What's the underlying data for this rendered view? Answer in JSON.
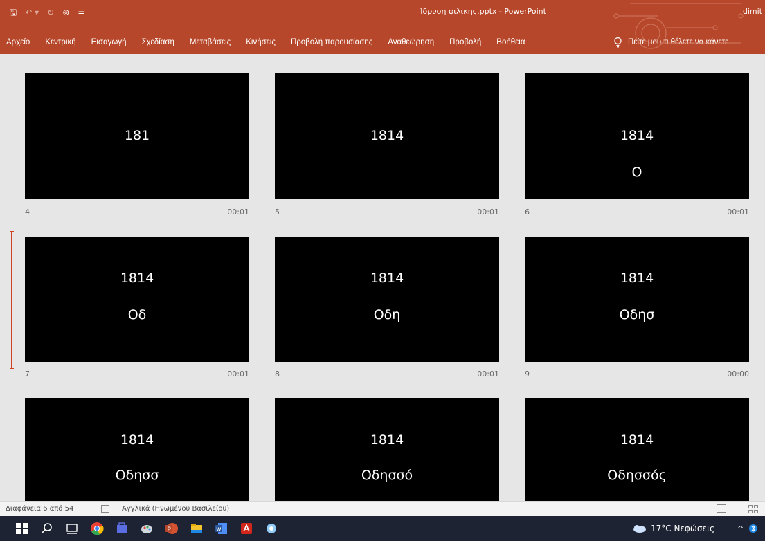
{
  "titlebar": {
    "qat_save": "🖫",
    "qat_undo": "↶ ▾",
    "qat_redo": "↻",
    "qat_present": "⊚",
    "qat_more": "=",
    "document_title": "Ίδρυση φιλικης.pptx  -  PowerPoint",
    "user": "dimit"
  },
  "ribbon": {
    "tabs": [
      "Αρχείο",
      "Κεντρική",
      "Εισαγωγή",
      "Σχεδίαση",
      "Μεταβάσεις",
      "Κινήσεις",
      "Προβολή παρουσίασης",
      "Αναθεώρηση",
      "Προβολή",
      "Βοήθεια"
    ],
    "tell_me": "Πείτε μου τι θέλετε να κάνετε"
  },
  "slides": [
    {
      "number": "4",
      "time": "00:01",
      "line1": "181",
      "line2": ""
    },
    {
      "number": "5",
      "time": "00:01",
      "line1": "1814",
      "line2": ""
    },
    {
      "number": "6",
      "time": "00:01",
      "line1": "1814",
      "line2": "Ο"
    },
    {
      "number": "7",
      "time": "00:01",
      "line1": "1814",
      "line2": "Οδ"
    },
    {
      "number": "8",
      "time": "00:01",
      "line1": "1814",
      "line2": "Οδη"
    },
    {
      "number": "9",
      "time": "00:00",
      "line1": "1814",
      "line2": "Οδησ"
    },
    {
      "number": "",
      "time": "",
      "line1": "1814",
      "line2": "Οδησσ"
    },
    {
      "number": "",
      "time": "",
      "line1": "1814",
      "line2": "Οδησσό"
    },
    {
      "number": "",
      "time": "",
      "line1": "1814",
      "line2": "Οδησσός"
    }
  ],
  "statusbar": {
    "slide_info": "Διαφάνεια 6 από 54",
    "language": "Αγγλικά (Ηνωμένου Βασιλείου)"
  },
  "taskbar": {
    "weather": "17°C  Νεφώσεις",
    "tray_chevron": "^"
  },
  "colors": {
    "ribbon": "#b7472a",
    "slide_background": "#000000",
    "selection_marker": "#d04423",
    "taskbar": "#1d2333"
  }
}
